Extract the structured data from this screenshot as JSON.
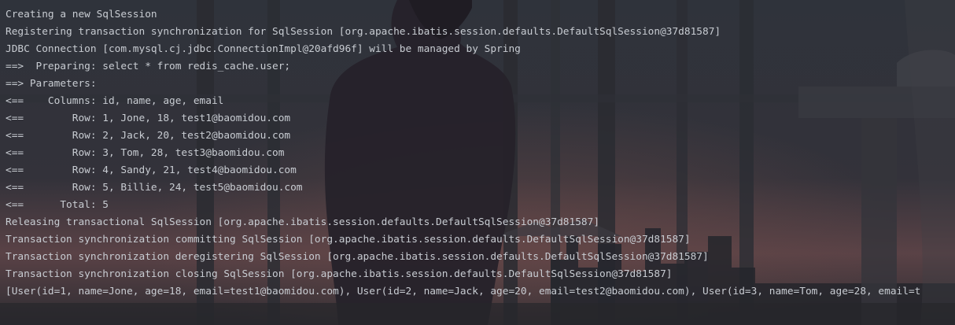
{
  "console": {
    "lines": [
      "Creating a new SqlSession",
      "Registering transaction synchronization for SqlSession [org.apache.ibatis.session.defaults.DefaultSqlSession@37d81587]",
      "JDBC Connection [com.mysql.cj.jdbc.ConnectionImpl@20afd96f] will be managed by Spring",
      "==>  Preparing: select * from redis_cache.user;",
      "==> Parameters: ",
      "<==    Columns: id, name, age, email",
      "<==        Row: 1, Jone, 18, test1@baomidou.com",
      "<==        Row: 2, Jack, 20, test2@baomidou.com",
      "<==        Row: 3, Tom, 28, test3@baomidou.com",
      "<==        Row: 4, Sandy, 21, test4@baomidou.com",
      "<==        Row: 5, Billie, 24, test5@baomidou.com",
      "<==      Total: 5",
      "Releasing transactional SqlSession [org.apache.ibatis.session.defaults.DefaultSqlSession@37d81587]",
      "Transaction synchronization committing SqlSession [org.apache.ibatis.session.defaults.DefaultSqlSession@37d81587]",
      "Transaction synchronization deregistering SqlSession [org.apache.ibatis.session.defaults.DefaultSqlSession@37d81587]",
      "Transaction synchronization closing SqlSession [org.apache.ibatis.session.defaults.DefaultSqlSession@37d81587]",
      "[User(id=1, name=Jone, age=18, email=test1@baomidou.com), User(id=2, name=Jack, age=20, email=test2@baomidou.com), User(id=3, name=Tom, age=28, email=t"
    ],
    "colors": {
      "text": "#c8ccd2",
      "background": "#2b2d30"
    }
  }
}
